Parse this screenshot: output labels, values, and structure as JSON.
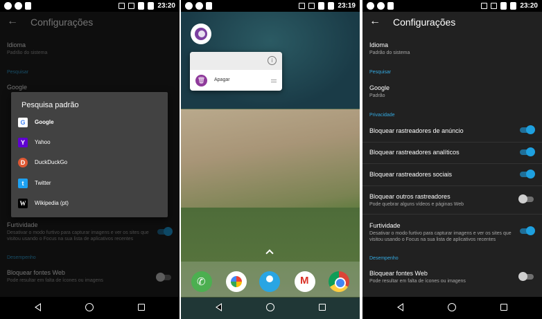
{
  "status": {
    "time_left": "23:20",
    "time_middle": "23:19",
    "time_right": "23:20"
  },
  "settings": {
    "title": "Configurações",
    "language_title": "Idioma",
    "language_value": "Padrão do sistema",
    "search_category": "Pesquisar",
    "search_title": "Google",
    "search_value": "Padrão",
    "privacy_category": "Privacidade",
    "block_ads": "Bloquear rastreadores de anúncio",
    "block_analytics": "Bloquear rastreadores analíticos",
    "block_social": "Bloquear rastreadores sociais",
    "block_other": "Bloquear outros rastreadores",
    "block_other_desc": "Pode quebrar alguns vídeos e páginas Web",
    "stealth_title": "Furtividade",
    "stealth_desc": "Desativar o modo furtivo para capturar imagens e ver os sites que visitou usando o Focus na sua lista de aplicativos recentes",
    "performance_category": "Desempenho",
    "block_fonts": "Bloquear fontes Web",
    "block_fonts_desc": "Pode resultar em falta de ícones ou imagens",
    "toggles": {
      "block_ads": true,
      "block_analytics": true,
      "block_social": true,
      "block_other": false,
      "stealth": true,
      "block_fonts": false
    }
  },
  "dialog": {
    "title": "Pesquisa padrão",
    "engines": [
      {
        "label": "Google",
        "icon": "google-icon",
        "color": "#ffffff",
        "selected": true
      },
      {
        "label": "Yahoo",
        "icon": "yahoo-icon",
        "color": "#5f01d1"
      },
      {
        "label": "DuckDuckGo",
        "icon": "duckduckgo-icon",
        "color": "#de5833"
      },
      {
        "label": "Twitter",
        "icon": "twitter-icon",
        "color": "#1da1f2"
      },
      {
        "label": "Wikipedia (pt)",
        "icon": "wikipedia-icon",
        "color": "#000000"
      }
    ]
  },
  "home": {
    "shortcut_menu_item": "Apagar"
  },
  "colors": {
    "accent": "#1ea0df",
    "background": "#212121",
    "dialog": "#424242"
  }
}
